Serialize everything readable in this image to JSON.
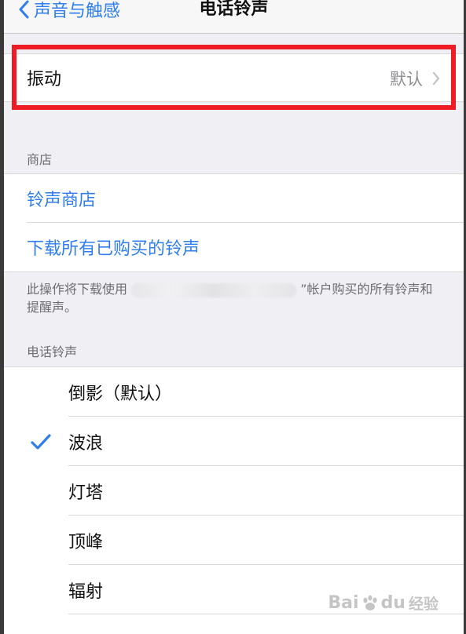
{
  "nav": {
    "back_label": "声音与触感",
    "title": "电话铃声"
  },
  "vibration": {
    "label": "振动",
    "value": "默认"
  },
  "store_section": {
    "header": "商店",
    "items": [
      {
        "label": "铃声商店"
      },
      {
        "label": "下载所有已购买的铃声"
      }
    ],
    "footer_prefix": "此操作将下载使用",
    "footer_suffix": "”帐户购买的所有铃声和提醒声。"
  },
  "ringtones_section": {
    "header": "电话铃声",
    "items": [
      {
        "label": "倒影（默认）",
        "selected": false
      },
      {
        "label": "波浪",
        "selected": true
      },
      {
        "label": "灯塔",
        "selected": false
      },
      {
        "label": "顶峰",
        "selected": false
      },
      {
        "label": "辐射",
        "selected": false
      }
    ]
  },
  "watermark": {
    "brand_left": "Bai",
    "brand_right": "du",
    "suffix": "经验"
  },
  "colors": {
    "accent": "#2f7ef0",
    "highlight": "#ee1c24",
    "secondary_text": "#8e8e93",
    "background": "#efeff4"
  }
}
